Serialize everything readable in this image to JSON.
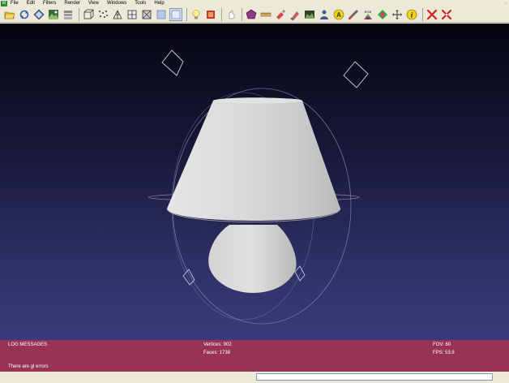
{
  "menu": {
    "app_icon_label": "M",
    "items": [
      "File",
      "Edit",
      "Filters",
      "Render",
      "View",
      "Windows",
      "Tools",
      "Help"
    ],
    "window_controls": [
      "_",
      "□",
      "×"
    ]
  },
  "toolbar": {
    "icons": [
      "open-folder-icon",
      "reload-icon",
      "save-mesh-icon",
      "snapshot-icon",
      "layers-icon",
      "bounding-box-icon",
      "points-icon",
      "wireframe-icon",
      "hidden-lines-icon",
      "flat-lines-icon",
      "flat-icon",
      "smooth-icon",
      "light-bulb-icon",
      "texture-icon",
      "hand-select-icon",
      "select-faces-icon",
      "measure-icon",
      "paint-icon",
      "move-icon",
      "landscape-icon",
      "georeference-icon",
      "annotate-icon",
      "brush-icon",
      "rgb-color-icon",
      "quality-icon",
      "move-tool-icon",
      "info-icon",
      "delete-faces-icon",
      "delete-vertices-icon"
    ],
    "rgb_label": "RGB",
    "annotate_label": "A",
    "info_label": "i"
  },
  "info": {
    "log_title": "LOG MESSAGES",
    "log_message": "There are gl errors",
    "vertices": "Vertices: 902",
    "faces": "Faces: 1738",
    "fov": "FOV: 60",
    "fps": "FPS:   53.8"
  },
  "colors": {
    "toolbar_bg": "#ece9d8",
    "viewport_top": "#050510",
    "viewport_bottom": "#3a3a7a",
    "info_panel_bg": "#993355",
    "mesh_color": "#d8d8d8"
  }
}
